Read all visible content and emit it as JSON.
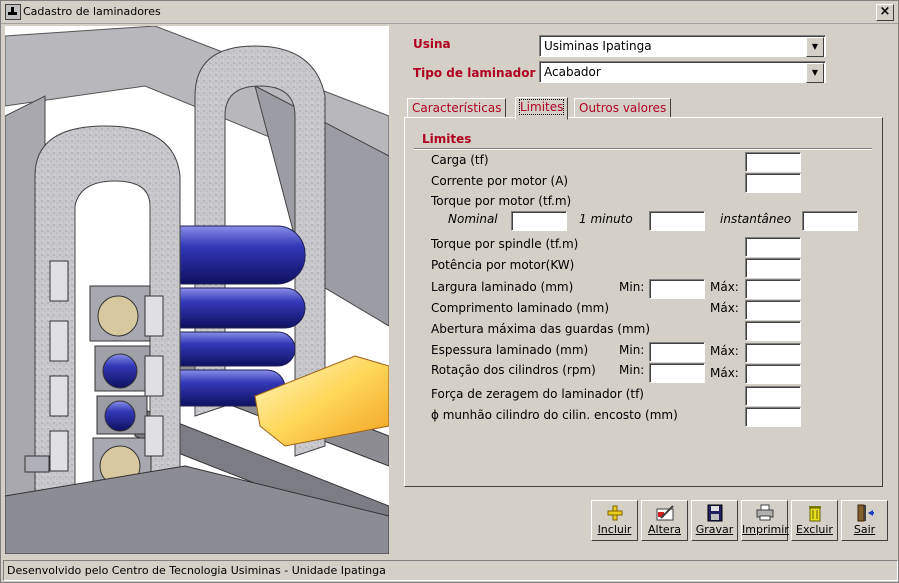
{
  "window": {
    "title": "Cadastro de laminadores"
  },
  "header": {
    "usina_label": "Usina",
    "usina_value": "Usiminas Ipatinga",
    "tipo_label": "Tipo de laminador",
    "tipo_value": "Acabador"
  },
  "tabs": [
    {
      "label": "Características"
    },
    {
      "label": "Limites"
    },
    {
      "label": "Outros valores"
    }
  ],
  "limites": {
    "section_title": "Limites",
    "carga": "Carga (tf)",
    "corrente": "Corrente por motor  (A)",
    "torque_motor": "Torque por motor (tf.m)",
    "nominal": "Nominal",
    "um_minuto": "1 minuto",
    "instantaneo": "instantâneo",
    "torque_spindle": "Torque por spindle (tf.m)",
    "potencia": "Potência por motor(KW)",
    "largura": "Largura laminado (mm)",
    "comprimento": "Comprimento laminado (mm)",
    "abertura": "Abertura máxima das guardas (mm)",
    "espessura": "Espessura laminado (mm)",
    "rotacao": "Rotação dos cilindros (rpm)",
    "forca": "Força de zeragem do laminador (tf)",
    "munhao": "ϕ munhão cilindro do cilin. encosto (mm)",
    "min_label": "Min:",
    "max_label": "Máx:"
  },
  "toolbar": {
    "incluir": "Incluir",
    "altera": "Altera",
    "gravar": "Gravar",
    "imprimir": "Imprimir",
    "excluir": "Excluir",
    "sair": "Sair"
  },
  "status": {
    "text": "Desenvolvido pelo Centro de Tecnologia Usiminas - Unidade Ipatinga"
  }
}
